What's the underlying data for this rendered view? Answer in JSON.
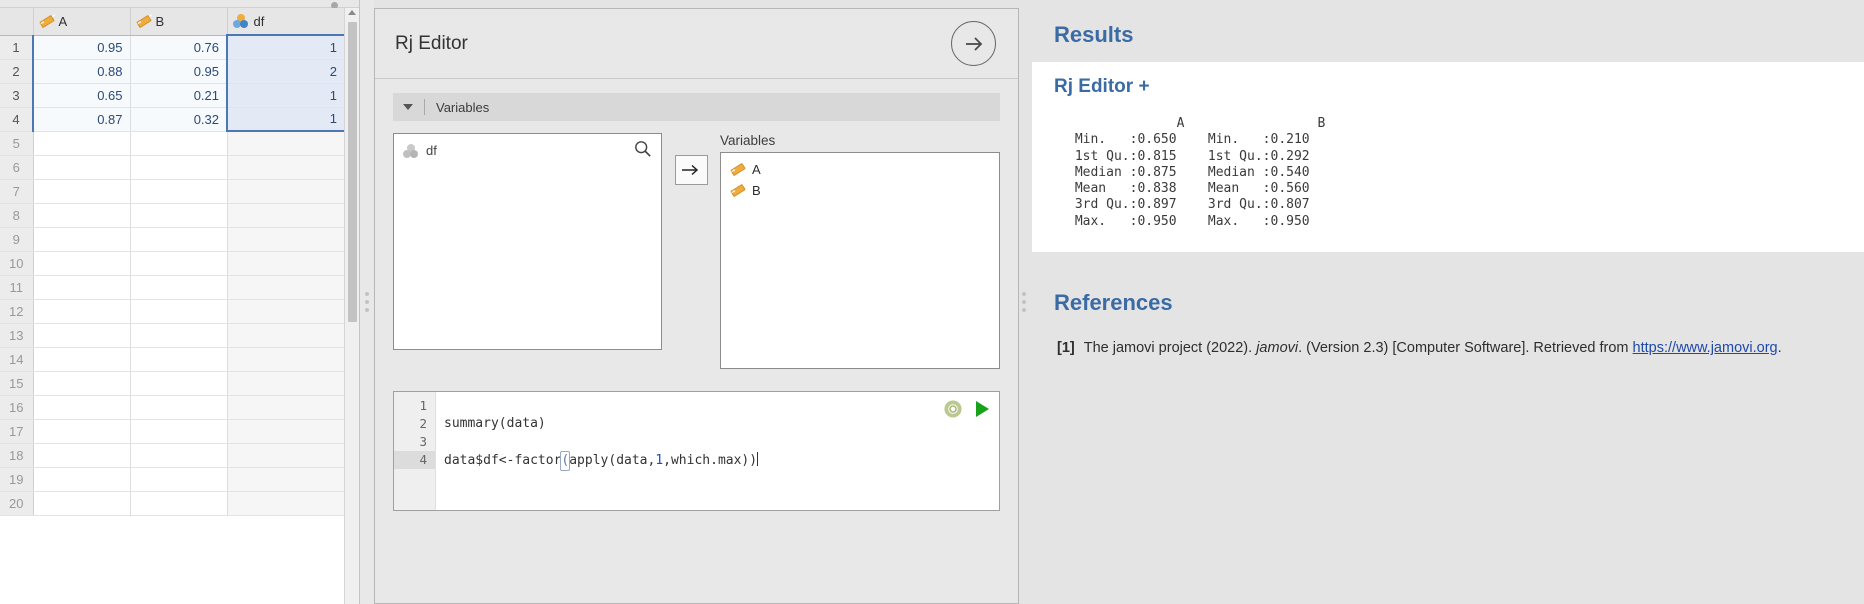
{
  "spreadsheet": {
    "columns": [
      {
        "name": "A",
        "icon": "ruler-continuous-icon"
      },
      {
        "name": "B",
        "icon": "ruler-continuous-icon"
      },
      {
        "name": "df",
        "icon": "nominal-icon"
      }
    ],
    "rows": [
      {
        "num": "1",
        "A": "0.95",
        "B": "0.76",
        "df": "1"
      },
      {
        "num": "2",
        "A": "0.88",
        "B": "0.95",
        "df": "2"
      },
      {
        "num": "3",
        "A": "0.65",
        "B": "0.21",
        "df": "1"
      },
      {
        "num": "4",
        "A": "0.87",
        "B": "0.32",
        "df": "1"
      },
      {
        "num": "5",
        "A": "",
        "B": "",
        "df": ""
      },
      {
        "num": "6",
        "A": "",
        "B": "",
        "df": ""
      },
      {
        "num": "7",
        "A": "",
        "B": "",
        "df": ""
      },
      {
        "num": "8",
        "A": "",
        "B": "",
        "df": ""
      },
      {
        "num": "9",
        "A": "",
        "B": "",
        "df": ""
      },
      {
        "num": "10",
        "A": "",
        "B": "",
        "df": ""
      },
      {
        "num": "11",
        "A": "",
        "B": "",
        "df": ""
      },
      {
        "num": "12",
        "A": "",
        "B": "",
        "df": ""
      },
      {
        "num": "13",
        "A": "",
        "B": "",
        "df": ""
      },
      {
        "num": "14",
        "A": "",
        "B": "",
        "df": ""
      },
      {
        "num": "15",
        "A": "",
        "B": "",
        "df": ""
      },
      {
        "num": "16",
        "A": "",
        "B": "",
        "df": ""
      },
      {
        "num": "17",
        "A": "",
        "B": "",
        "df": ""
      },
      {
        "num": "18",
        "A": "",
        "B": "",
        "df": ""
      },
      {
        "num": "19",
        "A": "",
        "B": "",
        "df": ""
      },
      {
        "num": "20",
        "A": "",
        "B": "",
        "df": ""
      }
    ]
  },
  "options": {
    "title": "Rj Editor",
    "collapse_label": "Variables",
    "source": {
      "items": [
        {
          "label": "df",
          "icon": "nominal-icon"
        }
      ]
    },
    "move_button_label": "→",
    "target": {
      "label": "Variables",
      "items": [
        {
          "label": "A",
          "icon": "ruler-continuous-icon"
        },
        {
          "label": "B",
          "icon": "ruler-continuous-icon"
        }
      ]
    },
    "code": {
      "line_numbers": [
        "1",
        "2",
        "3",
        "4"
      ],
      "lines": [
        "",
        "summary(data)",
        "",
        "data$df<-factor(apply(data,1,which.max))"
      ],
      "line2_text": "summary(data)",
      "line4_a": "data$df<-factor",
      "line4_b": "(",
      "line4_c": "apply(data,",
      "line4_d": "1",
      "line4_e": ",which.max))"
    }
  },
  "results": {
    "title": "Results",
    "analysis_heading": "Rj Editor +",
    "output": "              A                 B\n Min.   :0.650    Min.   :0.210\n 1st Qu.:0.815    1st Qu.:0.292\n Median :0.875    Median :0.540\n Mean   :0.838    Mean   :0.560\n 3rd Qu.:0.897    3rd Qu.:0.807\n Max.   :0.950    Max.   :0.950",
    "references_title": "References",
    "reference": {
      "num": "[1]",
      "part1": "The jamovi project (2022). ",
      "italic": "jamovi",
      "part2": ". (Version 2.3) [Computer Software]. Retrieved from ",
      "link": "https://www.jamovi.org",
      "part3": "."
    }
  },
  "chart_data": {
    "type": "table",
    "title": "summary(data)",
    "categories": [
      "Min.",
      "1st Qu.",
      "Median",
      "Mean",
      "3rd Qu.",
      "Max."
    ],
    "series": [
      {
        "name": "A",
        "values": [
          0.65,
          0.815,
          0.875,
          0.838,
          0.897,
          0.95
        ]
      },
      {
        "name": "B",
        "values": [
          0.21,
          0.292,
          0.54,
          0.56,
          0.807,
          0.95
        ]
      }
    ]
  }
}
